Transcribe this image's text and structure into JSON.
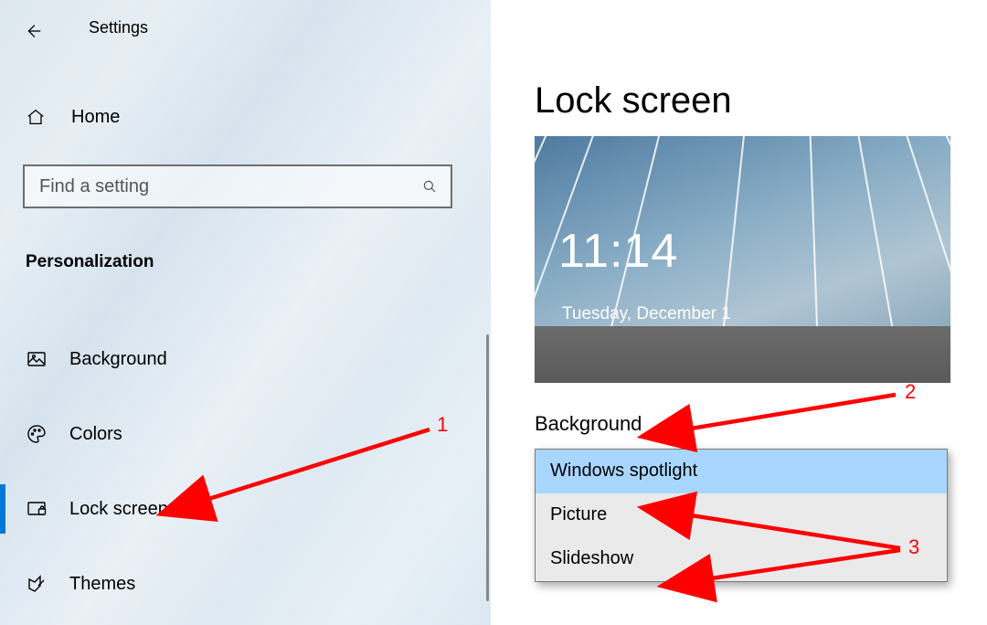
{
  "header": {
    "title": "Settings"
  },
  "sidebar": {
    "home_label": "Home",
    "search_placeholder": "Find a setting",
    "category": "Personalization",
    "items": [
      {
        "label": "Background"
      },
      {
        "label": "Colors"
      },
      {
        "label": "Lock screen",
        "selected": true
      },
      {
        "label": "Themes"
      }
    ]
  },
  "page": {
    "title": "Lock screen",
    "preview": {
      "time": "11:14",
      "date": "Tuesday, December 1"
    },
    "background_section_heading": "Background",
    "dropdown": {
      "options": [
        {
          "label": "Windows spotlight",
          "highlighted": true
        },
        {
          "label": "Picture"
        },
        {
          "label": "Slideshow"
        }
      ]
    }
  },
  "annotations": {
    "one": "1",
    "two": "2",
    "three": "3",
    "color": "#ff0000"
  }
}
